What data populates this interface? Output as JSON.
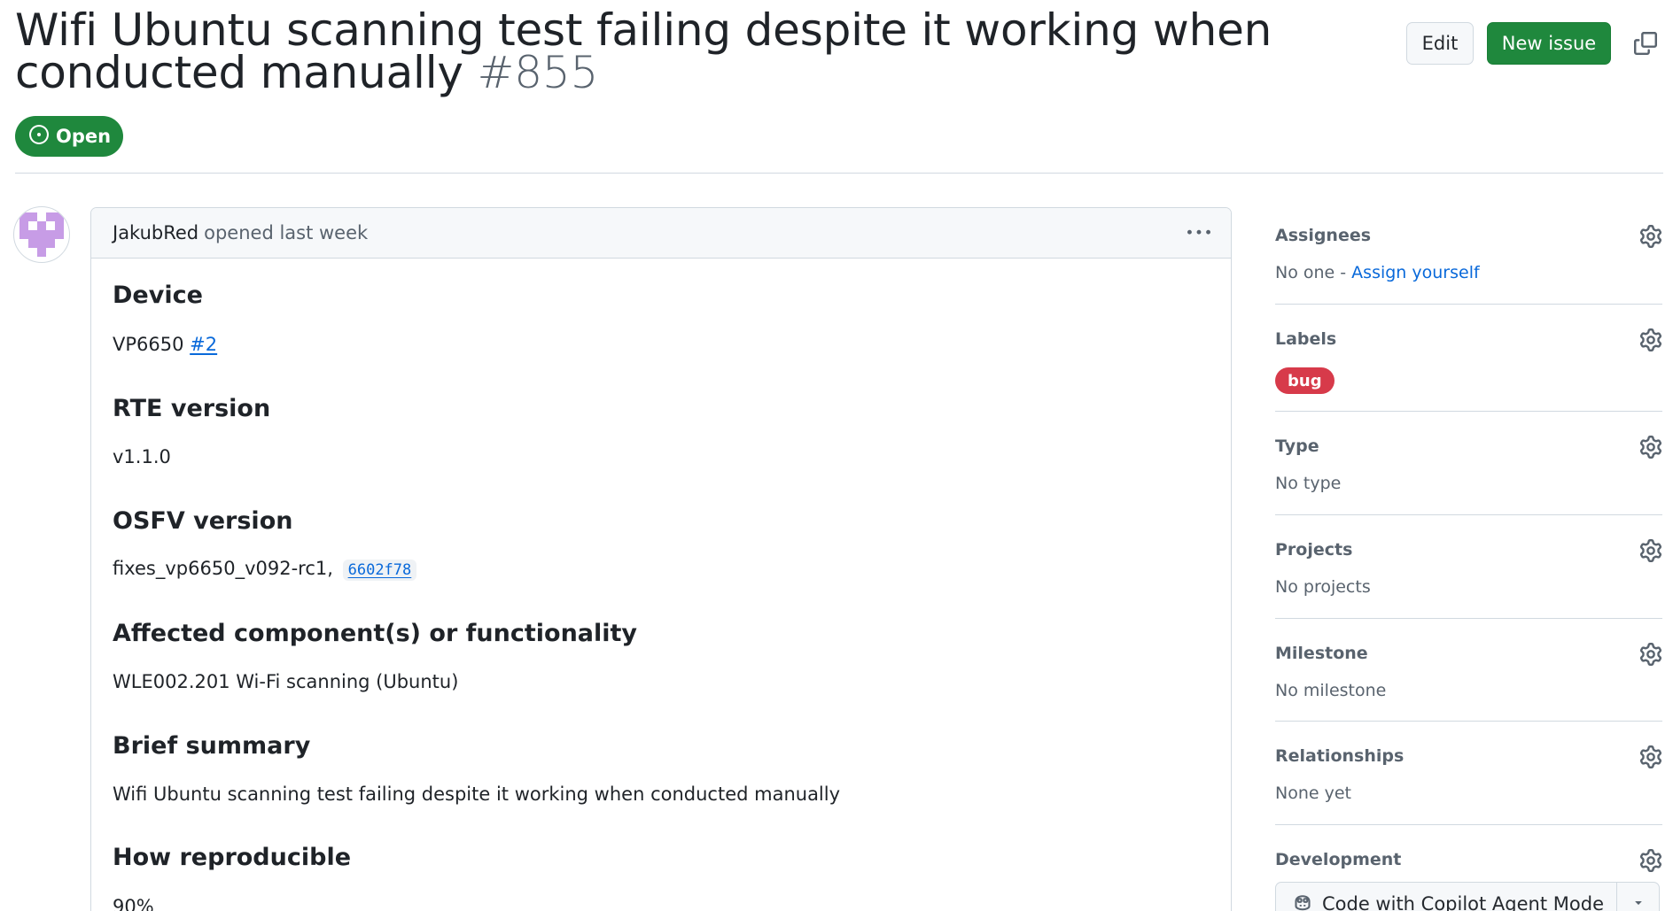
{
  "issue": {
    "title": "Wifi Ubuntu scanning test failing despite it working when conducted manually",
    "number": "#855",
    "state": "Open"
  },
  "header_actions": {
    "edit_label": "Edit",
    "new_issue_label": "New issue"
  },
  "comment": {
    "author": "JakubRed",
    "opened_text": "opened last week",
    "sections": [
      {
        "heading": "Device",
        "text": "VP6650",
        "link": "#2"
      },
      {
        "heading": "RTE version",
        "text": "v1.1.0"
      },
      {
        "heading": "OSFV version",
        "text": "fixes_vp6650_v092-rc1,",
        "sha": "6602f78"
      },
      {
        "heading": "Affected component(s) or functionality",
        "text": "WLE002.201 Wi-Fi scanning (Ubuntu)"
      },
      {
        "heading": "Brief summary",
        "text": "Wifi Ubuntu scanning test failing despite it working when conducted manually"
      },
      {
        "heading": "How reproducible",
        "text": "90%"
      }
    ]
  },
  "sidebar": {
    "assignees": {
      "title": "Assignees",
      "value_prefix": "No one - ",
      "assign_link": "Assign yourself"
    },
    "labels": {
      "title": "Labels",
      "items": [
        {
          "name": "bug",
          "color": "#d73a4a"
        }
      ]
    },
    "type": {
      "title": "Type",
      "value": "No type"
    },
    "projects": {
      "title": "Projects",
      "value": "No projects"
    },
    "milestone": {
      "title": "Milestone",
      "value": "No milestone"
    },
    "relationships": {
      "title": "Relationships",
      "value": "None yet"
    },
    "development": {
      "title": "Development",
      "copilot_button": "Code with Copilot Agent Mode"
    }
  },
  "colors": {
    "open_green": "#1f883d",
    "link_blue": "#0969da",
    "muted_text": "#59636e",
    "border": "#d1d9e0",
    "avatar_purple": "#c79ce6"
  },
  "icons": [
    "copy-link-icon",
    "issue-opened-icon",
    "kebab-menu-icon",
    "gear-icon",
    "copilot-icon",
    "triangle-down-icon"
  ]
}
